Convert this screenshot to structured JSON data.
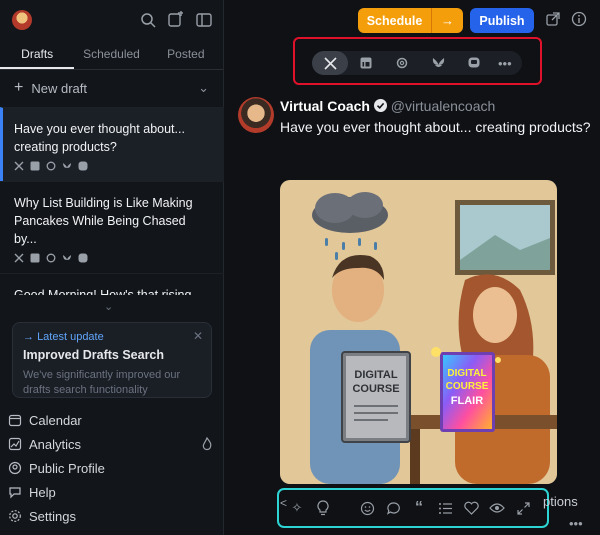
{
  "sidebar": {
    "tabs": [
      {
        "label": "Drafts",
        "active": true
      },
      {
        "label": "Scheduled",
        "active": false
      },
      {
        "label": "Posted",
        "active": false
      }
    ],
    "new_draft": "New draft",
    "drafts": [
      {
        "title": "Have you ever thought about... creating products?"
      },
      {
        "title": "Why List Building is Like Making Pancakes While Being Chased by..."
      },
      {
        "title": "Good Morning! How's that rising product in your launch..."
      }
    ],
    "update": {
      "tag": "Latest update",
      "heading": "Improved Drafts Search",
      "body": "We've significantly improved our drafts search functionality"
    },
    "nav": [
      {
        "label": "Calendar",
        "icon": "calendar-icon"
      },
      {
        "label": "Analytics",
        "icon": "analytics-icon"
      },
      {
        "label": "Public Profile",
        "icon": "profile-icon"
      },
      {
        "label": "Help",
        "icon": "help-icon"
      },
      {
        "label": "Settings",
        "icon": "settings-icon"
      }
    ]
  },
  "header": {
    "schedule_label": "Schedule",
    "publish_label": "Publish"
  },
  "platforms": [
    "x",
    "linkedin",
    "threads",
    "bluesky",
    "mastodon"
  ],
  "post": {
    "author_name": "Virtual Coach",
    "handle": "@virtualencoach",
    "text": "Have you ever thought about... creating products?",
    "image_text_book1": "DIGITAL COURSE",
    "image_text_book2": "DIGITAL COURSE FLAIR"
  },
  "toolbar": {
    "captions_label": "ptions"
  },
  "colors": {
    "accent_schedule": "#f59e0b",
    "accent_publish": "#2563eb",
    "highlight_red": "#e0122b",
    "highlight_cyan": "#2dd4d4"
  }
}
